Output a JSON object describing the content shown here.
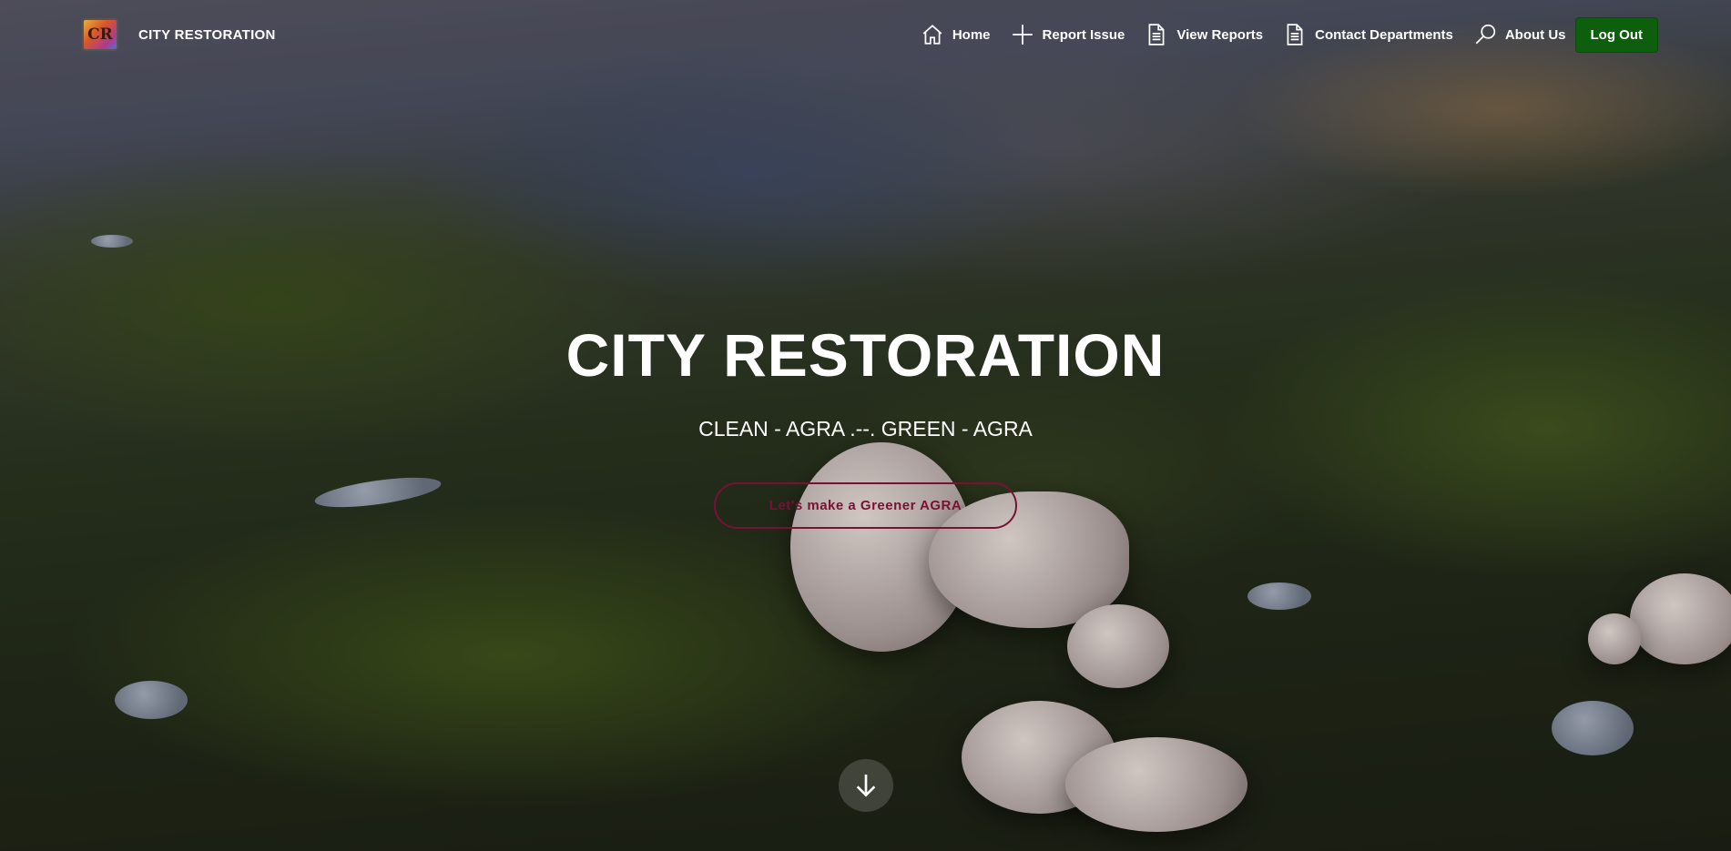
{
  "brand": {
    "logo_text": "CR",
    "name": "CITY RESTORATION"
  },
  "nav": {
    "items": [
      {
        "label": "Home",
        "icon": "home-icon"
      },
      {
        "label": "Report Issue",
        "icon": "plus-icon"
      },
      {
        "label": "View Reports",
        "icon": "document-icon"
      },
      {
        "label": "Contact Departments",
        "icon": "document-icon"
      },
      {
        "label": "About Us",
        "icon": "search-icon"
      }
    ],
    "logout_label": "Log Out"
  },
  "hero": {
    "title": "CITY RESTORATION",
    "subtitle": "CLEAN - AGRA .--. GREEN - AGRA",
    "cta_label": "Let's make a Greener AGRA",
    "scroll_icon": "arrow-down-icon"
  },
  "colors": {
    "logout_bg": "#0d5e0d",
    "cta_accent": "#7a1034"
  }
}
